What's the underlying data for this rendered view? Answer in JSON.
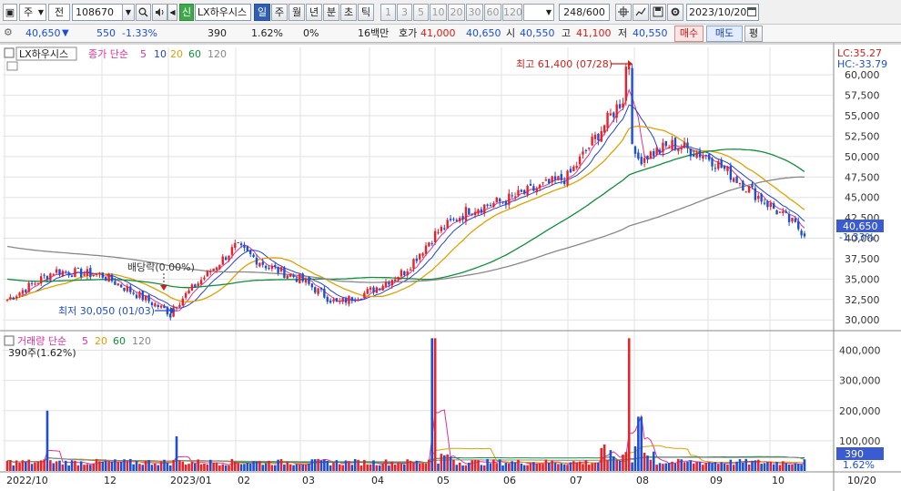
{
  "toolbar": {
    "dropdown_ju": "주",
    "dropdown_jeon": "전",
    "stock_code": "108670",
    "shin_label": "신",
    "stock_name": "LX하우시스",
    "period_buttons": [
      "일",
      "주",
      "월",
      "년",
      "분",
      "초",
      "틱"
    ],
    "period_active": "일",
    "interval_buttons": [
      "1",
      "3",
      "5",
      "10",
      "20",
      "30",
      "60",
      "120"
    ],
    "count": "248/600",
    "date": "2023/10/20"
  },
  "quote": {
    "price": "40,650",
    "arrow": "▼",
    "change": "550",
    "change_pct": "-1.33%",
    "value2": "390",
    "value2_pct": "1.62%",
    "value3": "0%",
    "trade_amount": "16백만",
    "hoga_label": "호가",
    "hoga_ask": "41,000",
    "hoga_bid": "40,650",
    "open_label": "시",
    "open": "40,550",
    "high_label": "고",
    "high": "41,100",
    "low_label": "저",
    "low": "40,550",
    "buy_button": "매수",
    "sell_button": "매도",
    "eval_button": "평"
  },
  "price_panel": {
    "stock_tag": "LX하우시스",
    "legend_prefix": "종가 단순",
    "ma_periods": [
      "5",
      "10",
      "20",
      "60",
      "120"
    ],
    "ma_colors": [
      "#e0309a",
      "#2244cc",
      "#e0a000",
      "#0f8f3a",
      "#888888"
    ],
    "lc": "LC:35.27",
    "hc": "HC:-33.79",
    "y_ticks": [
      "60,000",
      "57,500",
      "55,000",
      "52,500",
      "50,000",
      "47,500",
      "45,000",
      "42,500",
      "40,000",
      "37,500",
      "35,000",
      "32,500",
      "30,000"
    ],
    "last_price": "40,650",
    "last_pct": "-1.33%",
    "high_annotation": "최고 61,400 (07/28)",
    "low_annotation": "최저 30,050 (01/03)",
    "dividend_annotation": "배당락(0.00%)"
  },
  "volume_panel": {
    "legend_prefix": "거래량 단순",
    "ma_periods": [
      "5",
      "20",
      "60",
      "120"
    ],
    "ma_colors": [
      "#e0309a",
      "#e0a000",
      "#0f8f3a",
      "#888888"
    ],
    "volume_text": "390주(1.62%)",
    "y_ticks": [
      "400,000",
      "300,000",
      "200,000",
      "100,000"
    ],
    "last_volume": "390",
    "last_pct": "1.62%"
  },
  "x_axis": {
    "labels": [
      "2022/10",
      "12",
      "2023/01",
      "02",
      "03",
      "04",
      "05",
      "06",
      "07",
      "08",
      "09",
      "10"
    ],
    "last_label": "10/20"
  },
  "chart_data": {
    "type": "candlestick",
    "y_unit": "KRW",
    "ylim": [
      29000,
      62000
    ],
    "volume_ylim": [
      0,
      450000
    ],
    "anchors": {
      "x_labels": [
        "2022/10",
        "12",
        "2023/01",
        "02",
        "03",
        "04",
        "05",
        "06",
        "07",
        "08",
        "09",
        "10"
      ],
      "close_path": [
        [
          "2022/10",
          32500
        ],
        [
          "11",
          36000
        ],
        [
          "12",
          35500
        ],
        [
          "2023/01",
          31000
        ],
        [
          "02",
          39000
        ],
        [
          "mid-02",
          36500
        ],
        [
          "03",
          35000
        ],
        [
          "mid-03",
          32000
        ],
        [
          "04",
          33500
        ],
        [
          "mid-04",
          36000
        ],
        [
          "05",
          40500
        ],
        [
          "mid-05",
          43500
        ],
        [
          "06",
          44500
        ],
        [
          "07",
          47500
        ],
        [
          "07/28",
          58000
        ],
        [
          "08",
          49500
        ],
        [
          "mid-08",
          51500
        ],
        [
          "09",
          50000
        ],
        [
          "10",
          44000
        ],
        [
          "10/20",
          40650
        ]
      ],
      "volume_spikes": [
        [
          "2022/11 (early)",
          200000
        ],
        [
          "2023/01 (early)",
          115000
        ],
        [
          "05 (early)",
          440000
        ],
        [
          "07/28",
          440000
        ],
        [
          "08 (early)",
          180000
        ]
      ]
    },
    "legend": [
      "종가 단순 5",
      "10",
      "20",
      "60",
      "120"
    ]
  }
}
